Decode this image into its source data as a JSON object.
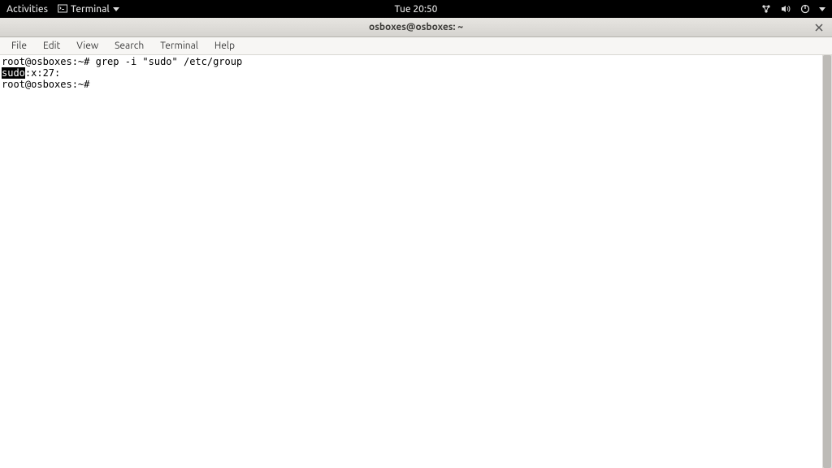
{
  "topbar": {
    "activities": "Activities",
    "app_name": "Terminal",
    "clock": "Tue 20:50"
  },
  "titlebar": {
    "title": "osboxes@osboxes: ~"
  },
  "menubar": {
    "file": "File",
    "edit": "Edit",
    "view": "View",
    "search": "Search",
    "terminal": "Terminal",
    "help": "Help"
  },
  "terminal": {
    "line1_prompt": "root@osboxes:~# ",
    "line1_cmd": "grep -i \"sudo\" /etc/group",
    "line2_highlight": "sudo",
    "line2_rest": ":x:27:",
    "line3_prompt": "root@osboxes:~# "
  }
}
